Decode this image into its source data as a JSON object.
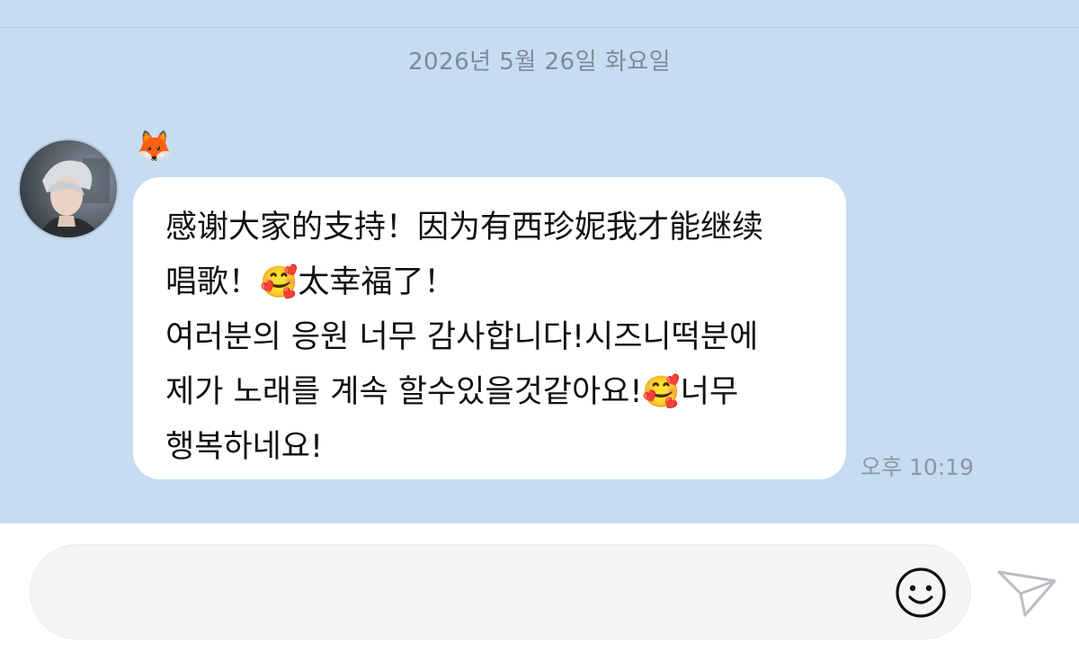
{
  "chat": {
    "date": "2026년 5월 26일 화요일",
    "sender_icon": "fox-emoji",
    "sender_emoji": "🦊",
    "message": {
      "line1": "感谢大家的支持！因为有西珍妮我才能继续",
      "line2_a": "唱歌！",
      "emoji": "🥰",
      "line2_b": "太幸福了！",
      "line3": "여러분의 응원 너무 감사합니다!시즈니떡분에",
      "line4_a": "제가 노래를 계속 할수있을것같아요!",
      "line4_b": "너무",
      "line5": "행복하네요!"
    },
    "time": "오후 10:19"
  },
  "composer": {
    "placeholder": "",
    "emoji_icon": "smiley-icon",
    "send_icon": "send-icon"
  },
  "colors": {
    "chat_background": "#c6dcf1",
    "bubble": "#ffffff",
    "composer_background": "#f5f5f5"
  }
}
